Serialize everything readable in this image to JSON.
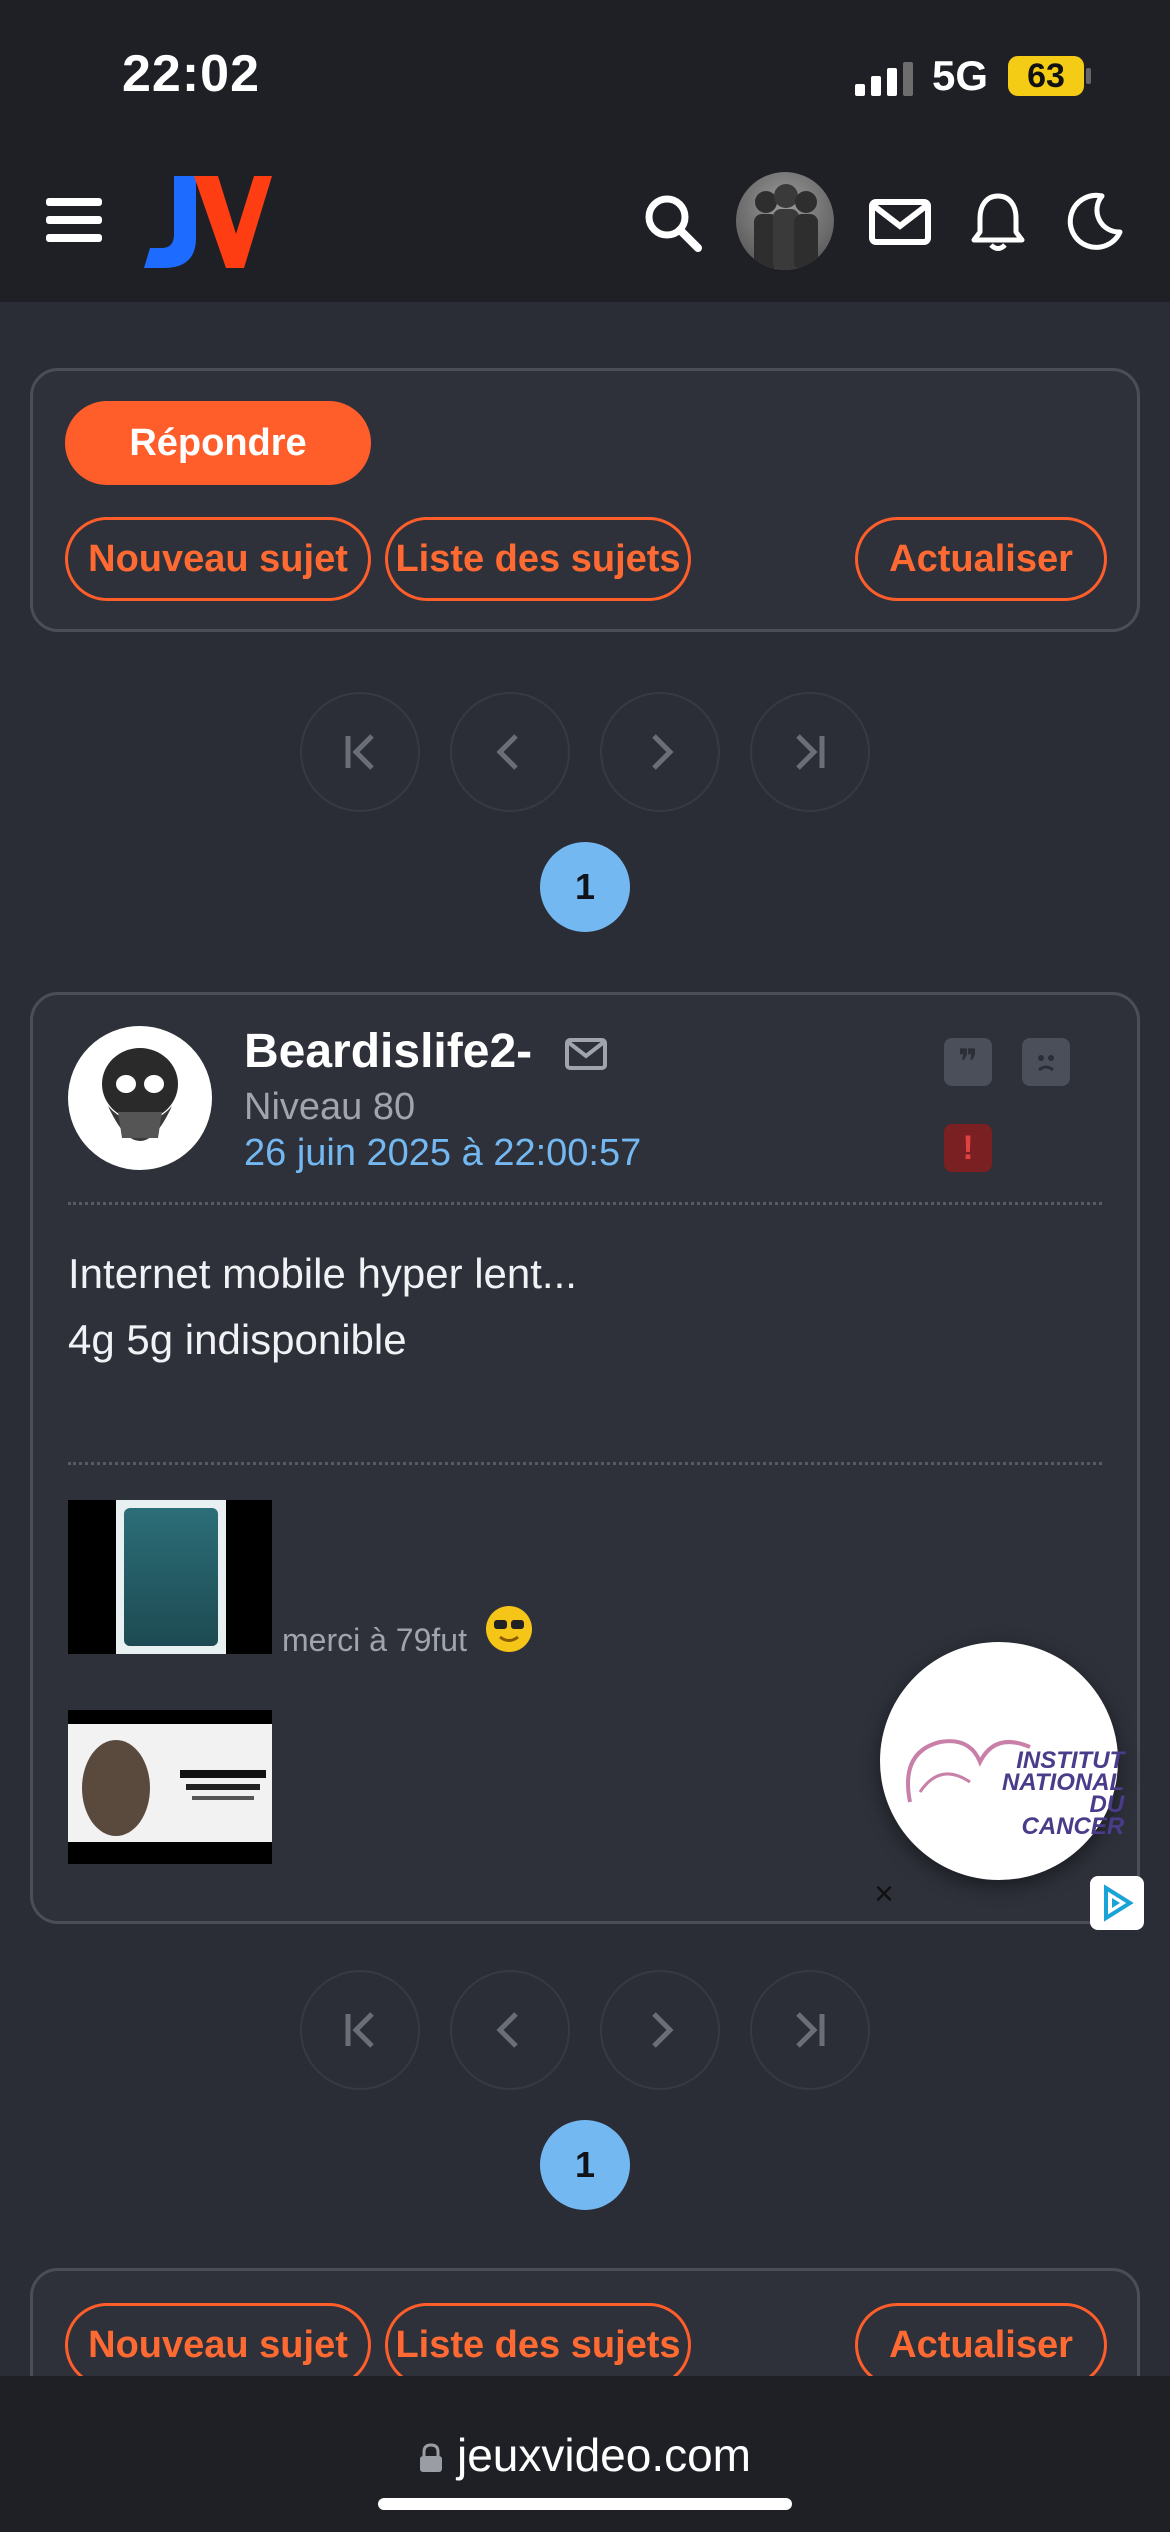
{
  "status_bar": {
    "time": "22:02",
    "network": "5G",
    "battery": "63"
  },
  "header": {
    "logo_label": "JV",
    "icons": [
      "menu-icon",
      "search-icon",
      "avatar",
      "mail-icon",
      "bell-icon",
      "moon-icon"
    ]
  },
  "actions_top": {
    "reply": "Répondre",
    "new_topic": "Nouveau sujet",
    "topic_list": "Liste des sujets",
    "refresh": "Actualiser"
  },
  "pagination": {
    "current_page": "1"
  },
  "post": {
    "username": "Beardislife2-",
    "level": "Niveau 80",
    "date": "26 juin 2025 à 22:00:57",
    "message_lines": [
      "Internet mobile hyper lent...",
      "4g 5g indisponible"
    ],
    "signature_text": "merci à 79fut"
  },
  "ad": {
    "brand_lines": [
      "INSTITUT",
      "NATIONAL",
      "DU CANCER"
    ],
    "close": "×"
  },
  "actions_bottom": {
    "new_topic": "Nouveau sujet",
    "topic_list": "Liste des sujets",
    "refresh": "Actualiser"
  },
  "browser": {
    "url": "jeuxvideo.com"
  },
  "colors": {
    "accent": "#ff5e2b",
    "link": "#74b8f2",
    "background": "#2a2d35"
  }
}
